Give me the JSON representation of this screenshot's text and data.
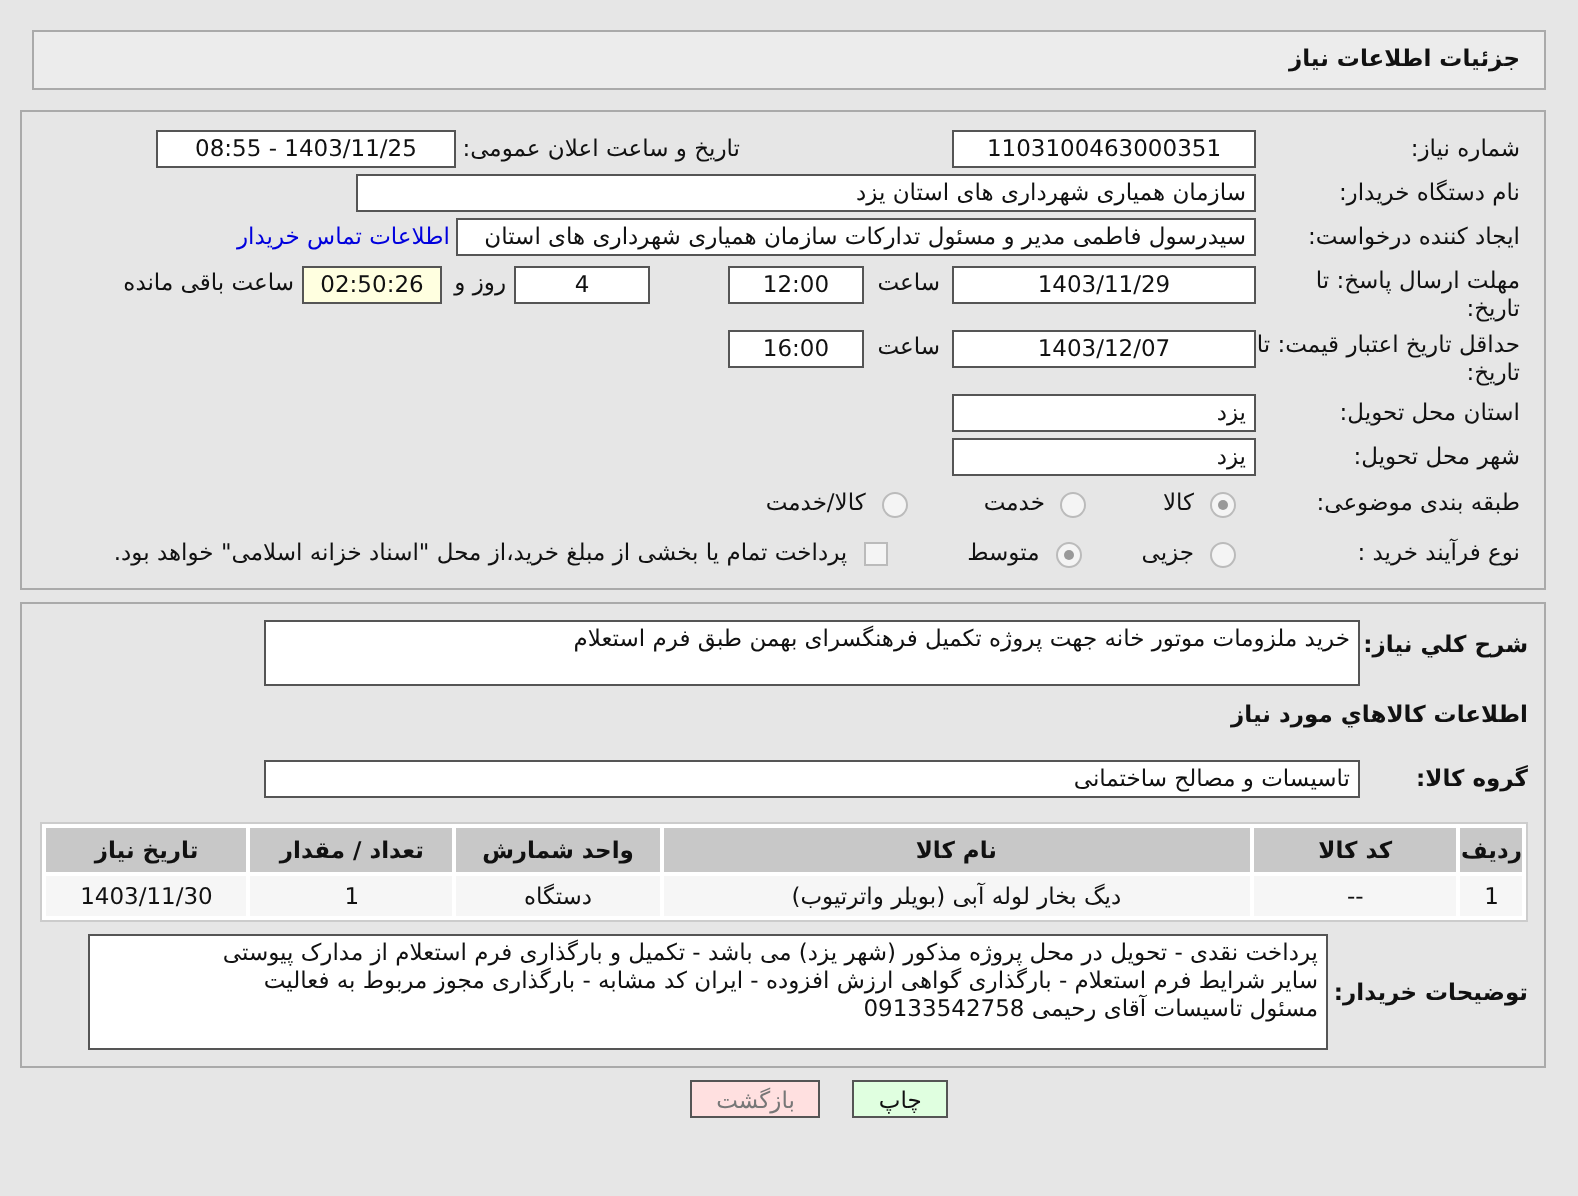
{
  "header": {
    "title": "جزئیات اطلاعات نیاز"
  },
  "need_number": {
    "label": "شماره نیاز:",
    "value": "1103100463000351"
  },
  "announce": {
    "label": "تاریخ و ساعت اعلان عمومی:",
    "value": "1403/11/25 - 08:55"
  },
  "buyer_org": {
    "label": "نام دستگاه خریدار:",
    "value": "سازمان همیاری شهرداری های استان یزد"
  },
  "creator": {
    "label": "ایجاد کننده درخواست:",
    "value": "سیدرسول فاطمی مدیر و مسئول تدارکات سازمان همیاری شهرداری های استان",
    "link": "اطلاعات تماس خریدار"
  },
  "deadline": {
    "label": "مهلت ارسال پاسخ: تا تاریخ:",
    "date": "1403/11/29",
    "time_label": "ساعت",
    "time": "12:00",
    "days": "4",
    "days_label": "روز و",
    "remaining": "02:50:26",
    "remaining_label": "ساعت باقی مانده"
  },
  "validity": {
    "label": "حداقل تاریخ اعتبار قیمت: تا تاریخ:",
    "date": "1403/12/07",
    "time_label": "ساعت",
    "time": "16:00"
  },
  "province": {
    "label": "استان محل تحویل:",
    "value": "یزد"
  },
  "city": {
    "label": "شهر محل تحویل:",
    "value": "یزد"
  },
  "category": {
    "label": "طبقه بندی موضوعی:",
    "options": [
      {
        "label": "کالا",
        "selected": true
      },
      {
        "label": "خدمت",
        "selected": false
      },
      {
        "label": "کالا/خدمت",
        "selected": false
      }
    ]
  },
  "process": {
    "label": "نوع فرآیند خرید :",
    "options": [
      {
        "label": "جزیی",
        "selected": false
      },
      {
        "label": "متوسط",
        "selected": true
      }
    ],
    "treasury": {
      "label": "پرداخت تمام یا بخشی از مبلغ خرید،از محل \"اسناد خزانه اسلامی\" خواهد بود.",
      "checked": false
    }
  },
  "summary": {
    "label": "شرح کلي نياز:",
    "value": "خرید ملزومات موتور خانه جهت پروژه تکمیل فرهنگسرای بهمن طبق فرم استعلام"
  },
  "goods_heading": "اطلاعات کالاهاي مورد نياز",
  "goods_group": {
    "label": "گروه کالا:",
    "value": "تاسیسات و مصالح ساختمانی"
  },
  "table": {
    "columns": [
      "ردیف",
      "کد کالا",
      "نام کالا",
      "واحد شمارش",
      "تعداد / مقدار",
      "تاریخ نیاز"
    ],
    "rows": [
      [
        "1",
        "--",
        "دیگ بخار لوله آبی (بویلر واترتیوب)",
        "دستگاه",
        "1",
        "1403/11/30"
      ]
    ]
  },
  "notes": {
    "label": "توضیحات خریدار:",
    "lines": [
      "پرداخت نقدی - تحویل در محل پروژه مذکور (شهر یزد) می باشد - تکمیل و بارگذاری فرم استعلام از مدارک پیوستی",
      "سایر شرایط فرم استعلام - بارگذاری گواهی ارزش افزوده - ایران کد مشابه - بارگذاری مجوز مربوط به فعالیت",
      "مسئول تاسیسات آقای رحیمی 09133542758"
    ]
  },
  "buttons": [
    {
      "label": "چاپ",
      "kind": "print"
    },
    {
      "label": "بازگشت",
      "kind": "back"
    }
  ]
}
